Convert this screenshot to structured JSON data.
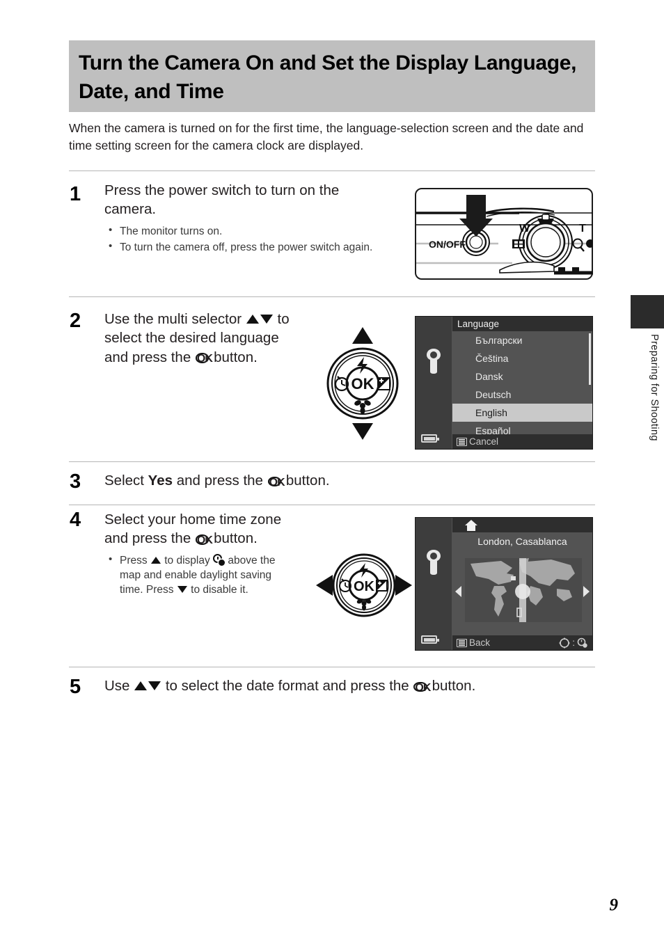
{
  "page": {
    "number": "9",
    "side_tab_label": "Preparing for Shooting",
    "title": "Turn the Camera On and Set the Display Language, Date, and Time",
    "intro": "When the camera is turned on for the first time, the language-selection screen and the date and time setting screen for the camera clock are displayed."
  },
  "steps": [
    {
      "num": "1",
      "heading": "Press the power switch to turn on the camera.",
      "bullets": [
        "The monitor turns on.",
        "To turn the camera off, press the power switch again."
      ]
    },
    {
      "num": "2",
      "heading_parts": {
        "a": "Use the multi selector ",
        "b": " to select the desired language and press the ",
        "c": " button."
      }
    },
    {
      "num": "3",
      "heading_parts": {
        "a": "Select ",
        "bold": "Yes",
        "b": " and press the ",
        "c": " button."
      }
    },
    {
      "num": "4",
      "heading_parts": {
        "a": "Select your home time zone and press the ",
        "c": " button."
      },
      "bullet_parts": {
        "a": "Press ",
        "b": " to display ",
        "c": " above the map and enable daylight saving time. Press ",
        "d": " to disable it."
      }
    },
    {
      "num": "5",
      "heading_parts": {
        "a": "Use ",
        "b": " to select the date format and press the ",
        "c": " button."
      }
    }
  ],
  "camera_illustration": {
    "onoff_label": "ON/OFF",
    "wide_label": "W",
    "tele_label": "T",
    "thumbnail_icon": "thumbnail-playback-icon",
    "magnifier_icon": "magnifier-zoom-icon",
    "arrow_icon": "press-down-arrow-icon"
  },
  "multi_selector": {
    "ok_label": "OK",
    "flash_icon": "flash-mode-icon",
    "self_timer_icon": "self-timer-icon",
    "exposure_icon": "exposure-compensation-icon",
    "macro_icon": "macro-flower-icon"
  },
  "language_screen": {
    "sidebar_icon": "setup-wrench-icon",
    "battery_icon": "battery-icon",
    "title": "Language",
    "options": [
      {
        "label": "Български",
        "selected": false
      },
      {
        "label": "Čeština",
        "selected": false
      },
      {
        "label": "Dansk",
        "selected": false
      },
      {
        "label": "Deutsch",
        "selected": false
      },
      {
        "label": "English",
        "selected": true
      },
      {
        "label": "Español",
        "selected": false
      }
    ],
    "bottom_action": "Cancel",
    "bottom_icon": "menu-button-icon"
  },
  "timezone_screen": {
    "sidebar_icon": "setup-wrench-icon",
    "battery_icon": "battery-icon",
    "home_icon": "home-timezone-icon",
    "city": "London, Casablanca",
    "bottom_action": "Back",
    "bottom_icon": "menu-button-icon",
    "indicator_left_icon": "multi-selector-globe-icon",
    "indicator_separator": ":",
    "indicator_right_icon": "daylight-saving-icon",
    "left_arrow_icon": "prev-timezone-arrow-icon",
    "right_arrow_icon": "next-timezone-arrow-icon"
  },
  "colors": {
    "title_band": "#bfbfbf",
    "rule": "#b5b5b5",
    "lcd_bg": "#535353",
    "lcd_sidebar": "#3d3d3d",
    "lcd_bar": "#2e2e2e",
    "lcd_highlight": "#c9c9c9",
    "tab_block": "#2b2b2b"
  }
}
